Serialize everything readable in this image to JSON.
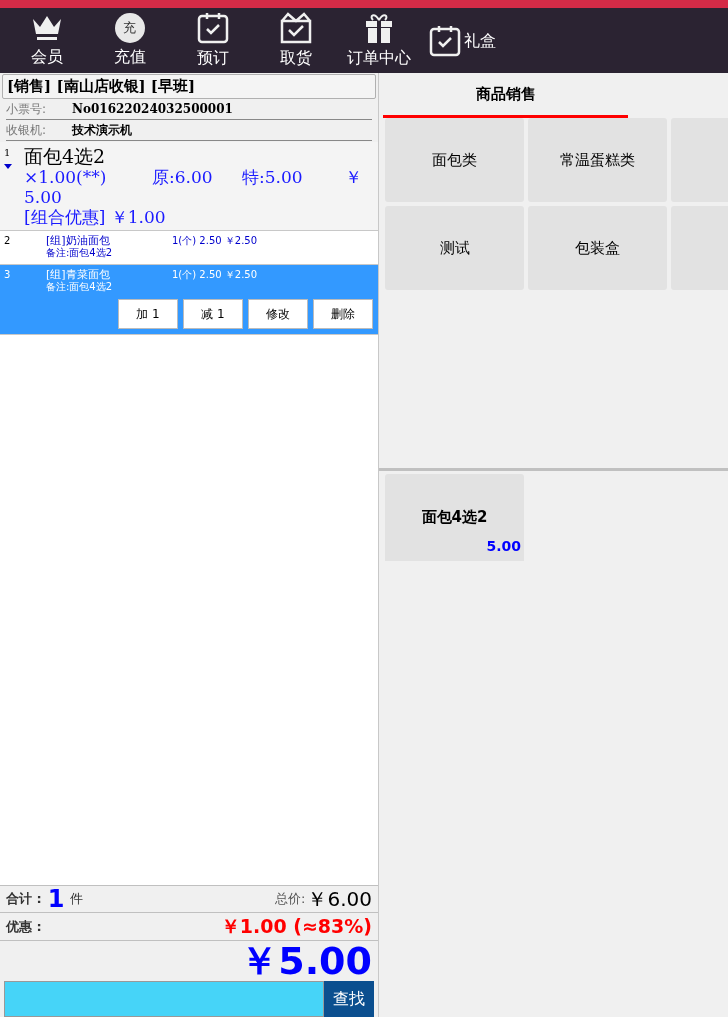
{
  "nav": [
    {
      "label": "会员",
      "kind": "crown"
    },
    {
      "label": "充值",
      "kind": "coin",
      "icon_text": "充"
    },
    {
      "label": "预订",
      "kind": "calendar"
    },
    {
      "label": "取货",
      "kind": "box"
    },
    {
      "label": "订单中心",
      "kind": "gift"
    },
    {
      "label": "礼盒",
      "kind": "side"
    }
  ],
  "order": {
    "header": "[销售] [南山店收银] [早班]",
    "fields": [
      {
        "label": "小票号:",
        "value": "No01622024032500001"
      },
      {
        "label": "收银机:",
        "value": "技术演示机"
      }
    ],
    "items": [
      {
        "kind": "combo",
        "index": "1",
        "name": "面包4选2",
        "qty": "×1.00(**)",
        "original": "原:6.00",
        "special": "特:5.00",
        "amount": "￥",
        "amount_cont": "5.00",
        "discount": "[组合优惠] ￥1.00",
        "expanded": true,
        "selected": false
      },
      {
        "kind": "component",
        "index": "2",
        "name": "[组]奶油面包",
        "note": "备注:面包4选2",
        "detail": "1(个) 2.50 ￥2.50",
        "selected": false
      },
      {
        "kind": "component",
        "index": "3",
        "name": "[组]青菜面包",
        "note": "备注:面包4选2",
        "detail": "1(个) 2.50 ￥2.50",
        "selected": true,
        "actions": [
          "加 1",
          "减 1",
          "修改",
          "删除"
        ]
      }
    ],
    "summary": {
      "count_label": "合计 :",
      "count": "1",
      "count_unit": "件",
      "total_label": "总价:",
      "total": "￥6.00",
      "discount_label": "优惠 :",
      "discount": "￥1.00 (≈83%)",
      "payable": "￥5.00"
    },
    "search": {
      "button": "查找"
    }
  },
  "catalog": {
    "tabs": [
      {
        "label": "商品销售",
        "selected": true
      }
    ],
    "categories": [
      {
        "kind": "named",
        "label": "面包类"
      },
      {
        "kind": "named",
        "label": "常温蛋糕类"
      },
      {
        "kind": "cut"
      },
      {
        "kind": "named",
        "label": "测试"
      },
      {
        "kind": "named",
        "label": "包装盒"
      },
      {
        "kind": "cut"
      }
    ],
    "products": [
      {
        "name": "面包4选2",
        "price": "5.00"
      }
    ]
  }
}
